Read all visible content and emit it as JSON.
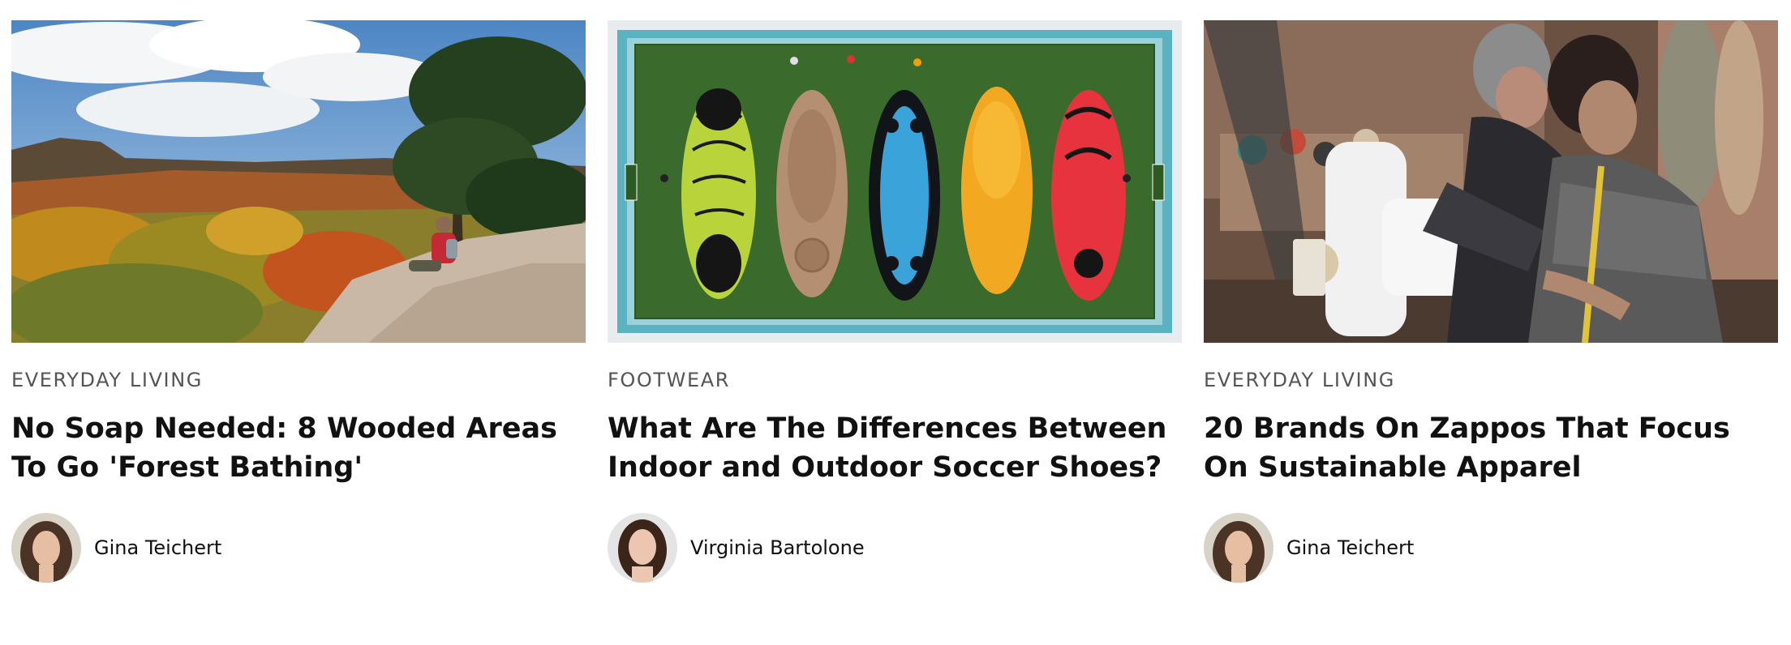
{
  "articles": [
    {
      "category": "EVERYDAY LIVING",
      "title": "No Soap Needed: 8 Wooded Areas To Go 'Forest Bathing'",
      "author": "Gina Teichert",
      "image": "hiker-overlooking-autumn-forest"
    },
    {
      "category": "FOOTWEAR",
      "title": "What Are The Differences Between Indoor and Outdoor Soccer Shoes?",
      "author": "Virginia Bartolone",
      "image": "soccer-shoe-soles-on-turf-field"
    },
    {
      "category": "EVERYDAY LIVING",
      "title": "20 Brands On Zappos That Focus On Sustainable Apparel",
      "author": "Gina Teichert",
      "image": "women-at-sewing-machine"
    }
  ]
}
